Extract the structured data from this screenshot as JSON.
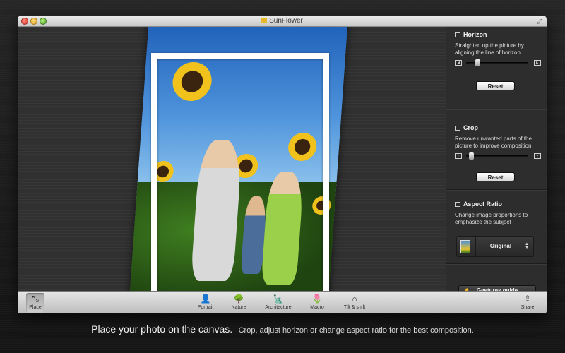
{
  "window": {
    "title": "SunFlower"
  },
  "panel": {
    "horizon": {
      "title": "Horizon",
      "description": "Straighten up the picture by aligning the line of horizon",
      "slider_value": 0.15,
      "reset_label": "Reset"
    },
    "crop": {
      "title": "Crop",
      "description": "Remove unwanted parts of the picture to improve composition",
      "slider_value": 0.05,
      "reset_label": "Reset"
    },
    "aspect_ratio": {
      "title": "Aspect Ratio",
      "description": "Change image proportions to emphasize the subject",
      "selected": "Original"
    },
    "gestures_label": "Gestures guide"
  },
  "toolbar": {
    "place": "Place",
    "portrait": "Portrait",
    "nature": "Nature",
    "architecture": "Architecture",
    "macro": "Macro",
    "tilt_shift": "Tilt & shift",
    "share": "Share"
  },
  "caption": {
    "headline": "Place your photo on the canvas.",
    "detail": "Crop, adjust horizon or change aspect ratio for the best composition."
  },
  "colors": {
    "panel_bg": "#2d2d2d",
    "toolbar_bg": "#d6d6d6",
    "frame": "#ffffff"
  }
}
